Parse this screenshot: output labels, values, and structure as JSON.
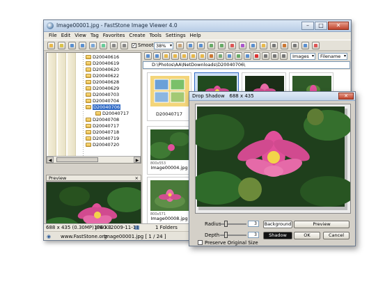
{
  "window": {
    "title": "Image00001.jpg - FastStone Image Viewer 4.0",
    "min_label": "–",
    "max_label": "□",
    "close_label": "✕"
  },
  "menu": [
    "File",
    "Edit",
    "View",
    "Tag",
    "Favorites",
    "Create",
    "Tools",
    "Settings",
    "Help"
  ],
  "toolbar": {
    "smooth_label": "Smooth",
    "smooth_checked": "✓",
    "zoom_value": "38%",
    "view_mode": "Images",
    "sort_by": "Filename"
  },
  "tree": {
    "folders": [
      "D20040616",
      "D20040619",
      "D20040620",
      "D20040622",
      "D20040628",
      "D20040629",
      "D20040703",
      "D20040704",
      "D20040706",
      "D20040717",
      "D20040708",
      "D20040717",
      "D20040718",
      "D20040719",
      "D20040720"
    ],
    "selected_index": 8
  },
  "preview_panel": {
    "title": "Preview",
    "close": "×"
  },
  "address": {
    "path": "D:\\Photos\\AA\\NetDownloads\\D20040706\\"
  },
  "thumbnails": [
    {
      "caption": "D20040717",
      "dim": ""
    },
    {
      "caption": "",
      "dim": ""
    },
    {
      "caption": "",
      "dim": ""
    },
    {
      "caption": "",
      "dim": ""
    },
    {
      "caption": "Image00004.jpg",
      "dim": "800x553"
    },
    {
      "caption": "Image00008.jpg",
      "dim": "800x571"
    }
  ],
  "status": {
    "image_info": "688 x 435 (0.30MP) JPEG",
    "file_size": "104 KB",
    "date": "2009-11-11",
    "folders": "1 Folders",
    "website": "www.FastStone.org",
    "current_file": "Image00001.jpg [ 1 / 24 ]"
  },
  "dialog": {
    "title": "Drop Shadow",
    "size": "688 x 435",
    "close_label": "✕",
    "radius_label": "Radius",
    "radius_value": "3",
    "depth_label": "Depth",
    "depth_value": "3",
    "background_label": "Background",
    "shadow_label": "Shadow",
    "preview_button": "Preview",
    "ok_button": "OK",
    "cancel_button": "Cancel",
    "preserve_label": "Preserve Original Size"
  },
  "colors": {
    "accent": "#316ac5",
    "flower": "#e0509a",
    "leaf": "#2f6b2a"
  }
}
